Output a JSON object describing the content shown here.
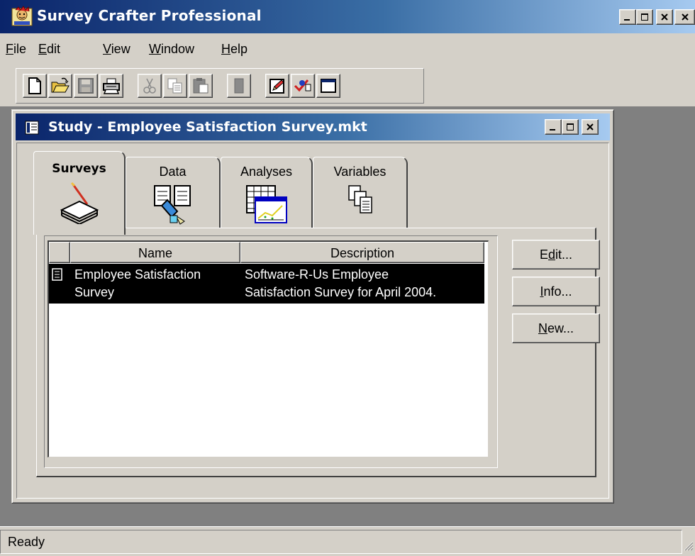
{
  "app": {
    "title": "Survey Crafter Professional"
  },
  "menu": {
    "items": [
      {
        "label": "File",
        "mnemonic": "F",
        "rest": "ile"
      },
      {
        "label": "Edit",
        "mnemonic": "E",
        "rest": "dit"
      },
      {
        "label": "View",
        "mnemonic": "V",
        "rest": "iew"
      },
      {
        "label": "Window",
        "mnemonic": "W",
        "rest": "indow"
      },
      {
        "label": "Help",
        "mnemonic": "H",
        "rest": "elp"
      }
    ]
  },
  "toolbar": {
    "buttons": [
      {
        "icon": "new-document-icon",
        "enabled": true
      },
      {
        "icon": "open-folder-icon",
        "enabled": true
      },
      {
        "icon": "save-disk-icon",
        "enabled": false
      },
      {
        "icon": "print-icon",
        "enabled": true
      },
      {
        "icon": "cut-scissors-icon",
        "enabled": false
      },
      {
        "icon": "copy-icon",
        "enabled": false
      },
      {
        "icon": "paste-icon",
        "enabled": false
      },
      {
        "icon": "blank-icon",
        "enabled": false
      },
      {
        "icon": "edit-pencil-icon",
        "enabled": true
      },
      {
        "icon": "spellcheck-icon",
        "enabled": true
      },
      {
        "icon": "window-icon",
        "enabled": true
      }
    ]
  },
  "child_window": {
    "title": "Study - Employee Satisfaction Survey.mkt"
  },
  "tabs": [
    {
      "label": "Surveys",
      "active": true,
      "icon": "survey-stack-icon"
    },
    {
      "label": "Data",
      "active": false,
      "icon": "data-documents-icon"
    },
    {
      "label": "Analyses",
      "active": false,
      "icon": "analysis-chart-icon"
    },
    {
      "label": "Variables",
      "active": false,
      "icon": "variables-pages-icon"
    }
  ],
  "list": {
    "columns": [
      "Name",
      "Description"
    ],
    "rows": [
      {
        "name_line1": "Employee Satisfaction",
        "name_line2": "Survey",
        "desc_line1": "Software-R-Us Employee",
        "desc_line2": "Satisfaction Survey for April 2004.",
        "selected": true
      }
    ]
  },
  "side_buttons": {
    "edit": {
      "pre": "E",
      "mnemonic": "d",
      "post": "it..."
    },
    "info": {
      "pre": "",
      "mnemonic": "I",
      "post": "nfo..."
    },
    "new": {
      "pre": "",
      "mnemonic": "N",
      "post": "ew..."
    }
  },
  "status": {
    "text": "Ready"
  },
  "colors": {
    "title_gradient_start": "#0a246a",
    "title_gradient_end": "#a6caf0",
    "face": "#d4d0c8",
    "mdi_background": "#808080",
    "selection": "#000000"
  }
}
